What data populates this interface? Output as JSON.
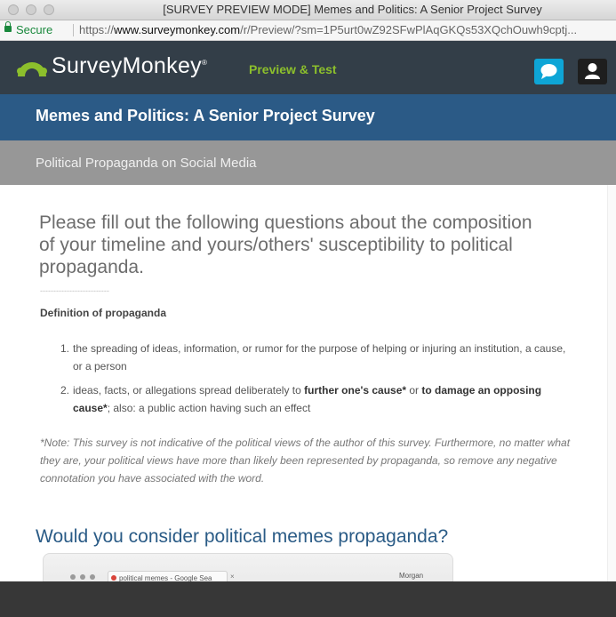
{
  "window": {
    "title": "[SURVEY PREVIEW MODE] Memes and Politics: A Senior Project Survey"
  },
  "address_bar": {
    "secure_label": "Secure",
    "url_scheme": "https://",
    "url_host": "www.surveymonkey.com",
    "url_path": "/r/Preview/?sm=1P5urt0wZ92SFwPlAqGKQs53XQchOuwh9cptj..."
  },
  "header": {
    "logo_text": "SurveyMonkey",
    "logo_reg": "®",
    "mode_label": "Preview & Test",
    "chat_icon": "speech-bubble-icon",
    "user_icon": "user-icon",
    "brand_color": "#8cbf2c",
    "header_color": "#333e48",
    "chat_color": "#0ea5d6"
  },
  "survey": {
    "title": "Memes and Politics: A Senior Project Survey",
    "page_title": "Political Propaganda on Social Media",
    "title_band_color": "#2b5a86"
  },
  "content": {
    "intro": "Please fill out the following questions about the composition of your timeline and yours/others' susceptibility to political propaganda.",
    "divider": "--------------------------",
    "definition_heading": "Definition of propaganda",
    "definitions": [
      {
        "num": "1.",
        "text": "the spreading of ideas, information, or rumor for the purpose of helping or injuring an institution, a cause, or a person"
      },
      {
        "num": "2.",
        "pre": "ideas, facts, or allegations spread deliberately to ",
        "bold1": "further one's cause*",
        "mid": " or ",
        "bold2": "to damage an opposing cause*",
        "post": "; also:  a public action having such an effect"
      }
    ],
    "note": "*Note: This survey is not indicative of the political views of the author of this survey. Furthermore, no matter what they are, your political views have more than likely been represented by propaganda, so remove any negative connotation you have associated with the word.",
    "question": "Would you consider political memes propaganda?"
  },
  "embedded_image": {
    "tab_label": "political memes - Google Sea",
    "tab_close": "×",
    "user_name": "Morgan"
  }
}
